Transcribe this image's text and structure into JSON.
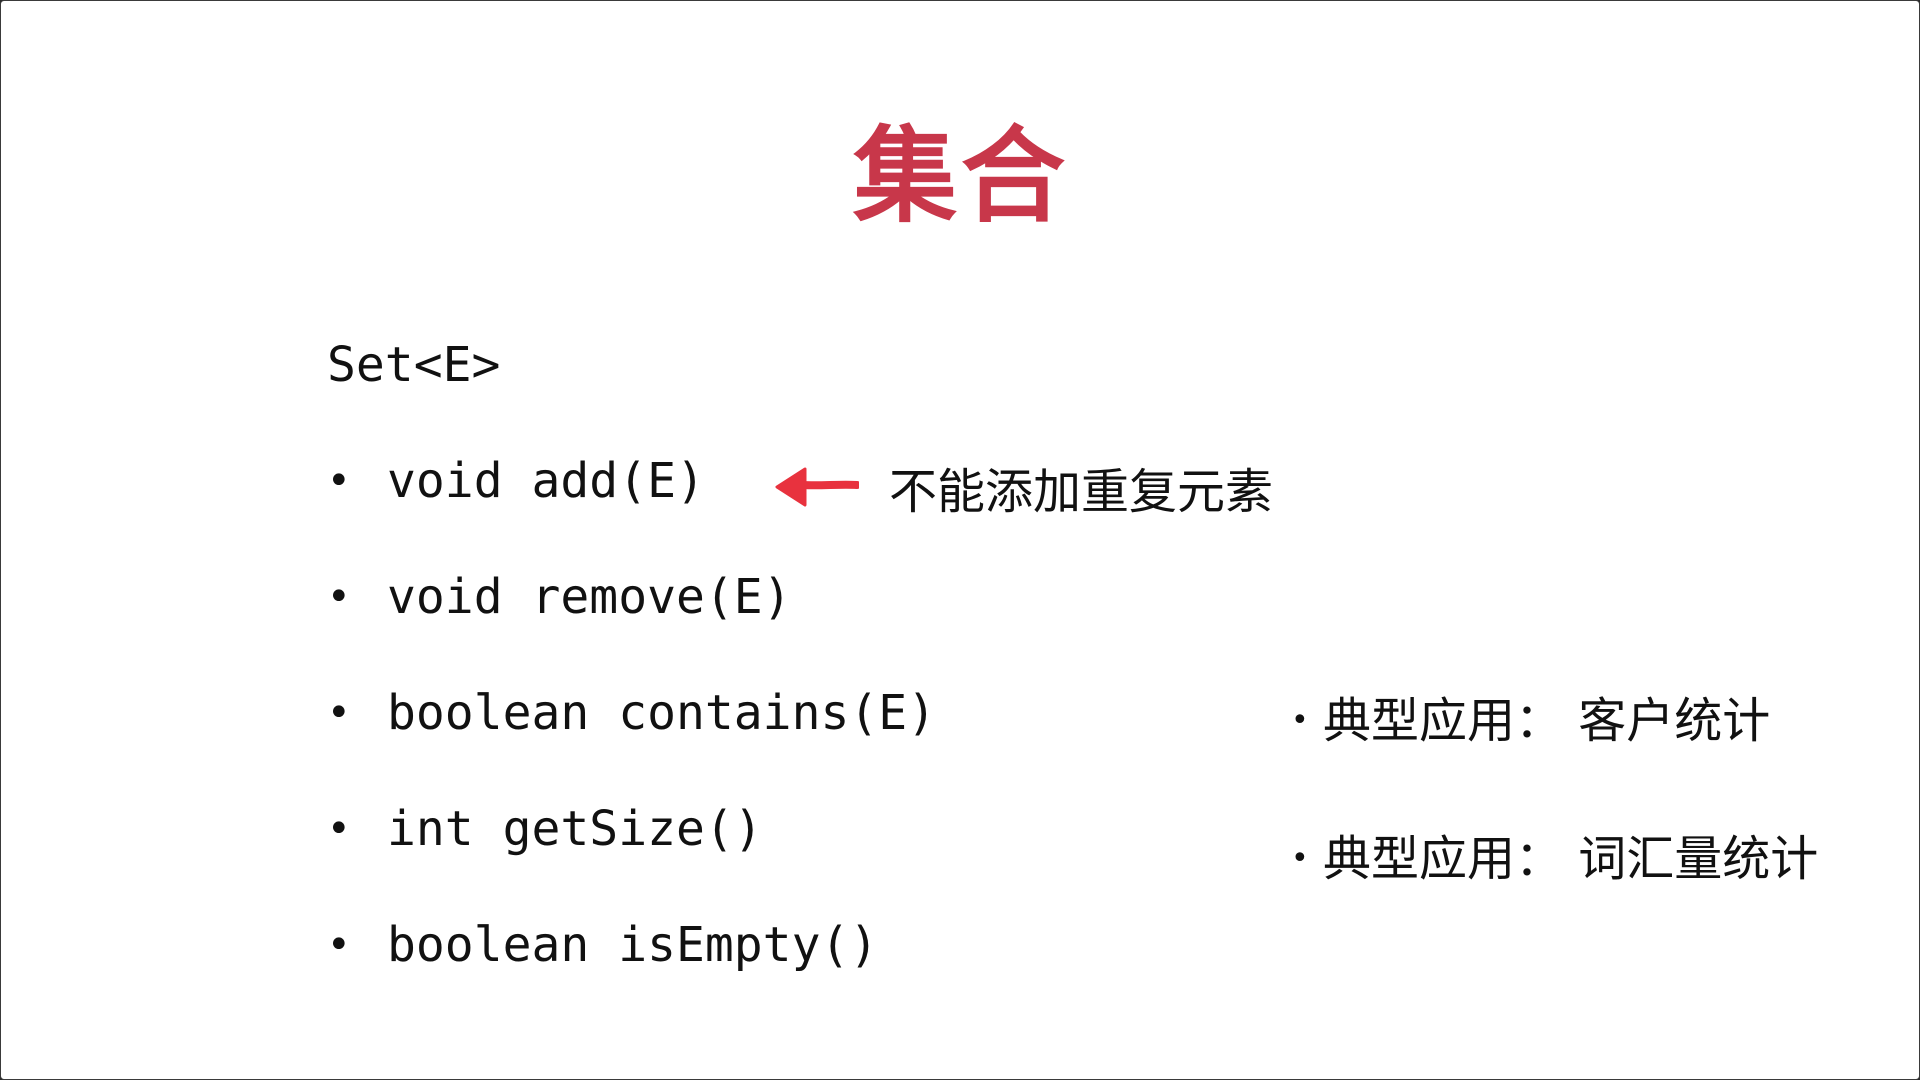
{
  "slide": {
    "title": "集合",
    "interface": "Set<E>",
    "bullet": "•",
    "methods": [
      {
        "signature": "void add(E)"
      },
      {
        "signature": "void remove(E)"
      },
      {
        "signature": "boolean contains(E)"
      },
      {
        "signature": "int getSize()"
      },
      {
        "signature": "boolean isEmpty()"
      }
    ],
    "note": {
      "text": "不能添加重复元素",
      "arrow_icon": "left-arrow-icon",
      "arrow_color": "#e8323e"
    },
    "applications": [
      {
        "text": "典型应用： 客户统计"
      },
      {
        "text": "典型应用： 词汇量统计"
      }
    ],
    "colors": {
      "title": "#c8374a",
      "text": "#111111",
      "background": "#ffffff"
    }
  }
}
